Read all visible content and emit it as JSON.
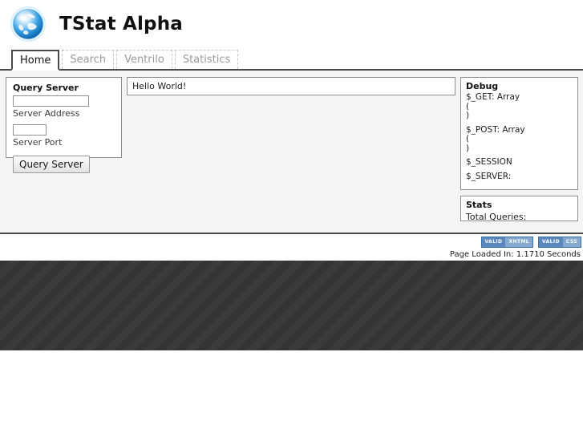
{
  "header": {
    "title": "TStat Alpha",
    "logo_icon": "globe-icon"
  },
  "tabs": [
    {
      "label": "Home",
      "active": true
    },
    {
      "label": "Search",
      "active": false
    },
    {
      "label": "Ventrilo",
      "active": false
    },
    {
      "label": "Statistics",
      "active": false
    }
  ],
  "query_panel": {
    "title": "Query Server",
    "address_value": "",
    "address_placeholder": "",
    "address_label": "Server Address",
    "port_value": "",
    "port_placeholder": "",
    "port_label": "Server Port",
    "submit_label": "Query Server"
  },
  "main_panel": {
    "message": "Hello World!"
  },
  "debug_panel": {
    "title": "Debug",
    "lines": [
      "$_GET: Array",
      "(",
      ")",
      "",
      "$_POST: Array",
      "(",
      ")",
      "",
      "$_SESSION",
      "",
      "$_SERVER:"
    ]
  },
  "stats_panel": {
    "title": "Stats",
    "total_queries_label": "Total Queries:"
  },
  "footer": {
    "badges": [
      {
        "left": "VALID",
        "right": "XHTML"
      },
      {
        "left": "VALID",
        "right": "CSS"
      }
    ],
    "load_time": "Page Loaded In: 1.1710 Seconds"
  },
  "colors": {
    "rule": "#4a4a4a",
    "content_bg": "#f4f4f4",
    "panel_border": "#8d8d8d",
    "badge_blue": "#5a88bd",
    "stripes_bg": "#3a3a3a"
  }
}
